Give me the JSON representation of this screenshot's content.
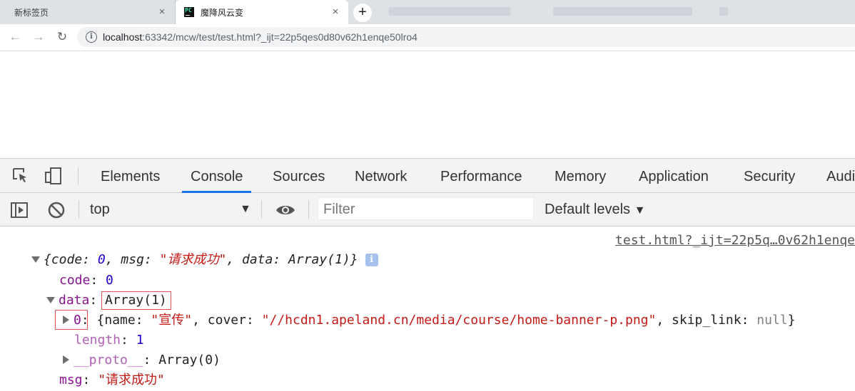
{
  "browser": {
    "tabs": [
      {
        "title": "新标签页"
      },
      {
        "title": "魔降风云变",
        "favicon": "PC"
      }
    ],
    "new_tab_symbol": "+",
    "close_symbol": "×",
    "address": {
      "host": "localhost",
      "rest": ":63342/mcw/test/test.html?_ijt=22p5qes0d80v62h1enqe50lro4"
    }
  },
  "devtools": {
    "tabs": [
      "Elements",
      "Console",
      "Sources",
      "Network",
      "Performance",
      "Memory",
      "Application",
      "Security",
      "Audi"
    ],
    "active_tab": "Console",
    "console_toolbar": {
      "context": "top",
      "filter_placeholder": "Filter",
      "levels": "Default levels"
    },
    "console": {
      "source_link": "test.html?_ijt=22p5q…0v62h1enqe",
      "summary": {
        "open": "{",
        "code_key": "code",
        "code_val": "0",
        "msg_key": "msg",
        "msg_val": "\"请求成功\"",
        "data_key": "data",
        "data_val": "Array(1)",
        "close": "}"
      },
      "code": {
        "key": "code",
        "value": "0"
      },
      "data": {
        "key": "data",
        "value": "Array(1)"
      },
      "item0": {
        "index": "0",
        "name_key": "name",
        "name_val": "\"宣传\"",
        "cover_key": "cover",
        "cover_val": "\"//hcdn1.apeland.cn/media/course/home-banner-p.png\"",
        "skip_key": "skip_link",
        "skip_val": "null"
      },
      "length": {
        "key": "length",
        "value": "1"
      },
      "proto": {
        "key": "__proto__",
        "value": "Array(0)"
      },
      "msg": {
        "key": "msg",
        "value": "\"请求成功\""
      }
    }
  }
}
